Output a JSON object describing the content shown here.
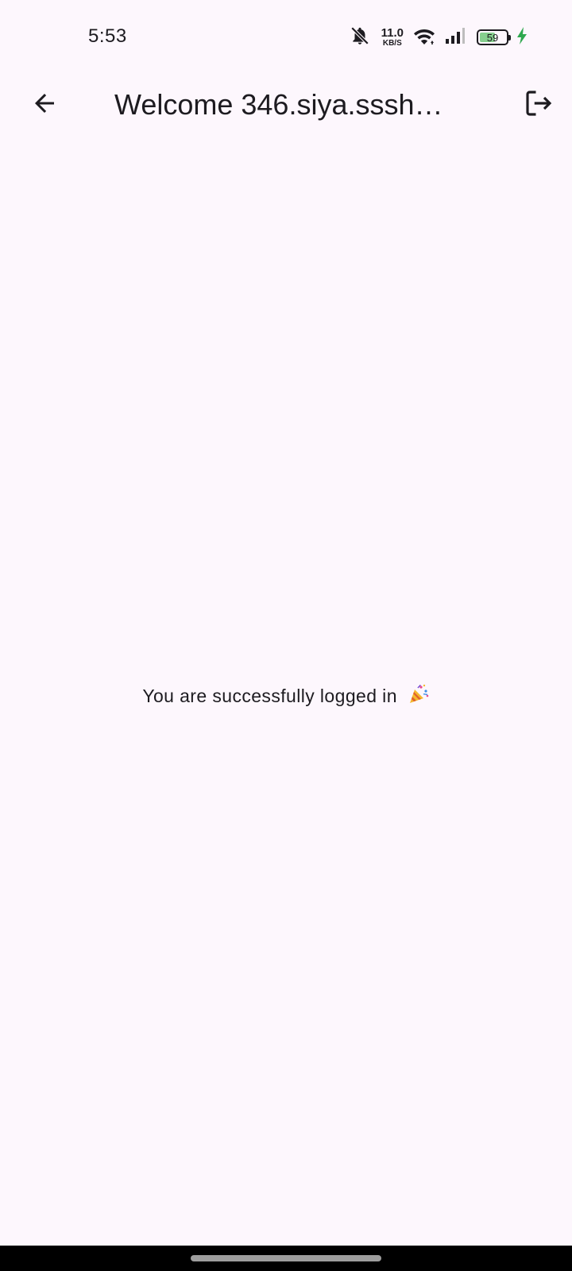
{
  "status_bar": {
    "time": "5:53",
    "net_speed_value": "11.0",
    "net_speed_unit": "KB/S",
    "battery_level": "59",
    "icons": [
      "bell-off-icon",
      "wifi-icon",
      "signal-icon",
      "battery-icon",
      "charging-bolt-icon"
    ]
  },
  "app_bar": {
    "title": "Welcome 346.siya.sssh…",
    "back_icon": "arrow-left-icon",
    "logout_icon": "logout-icon"
  },
  "body": {
    "message": "You are successfully logged in",
    "emoji_icon": "party-popper-icon"
  },
  "colors": {
    "background": "#fdf7fd",
    "text": "#1d1b20",
    "battery_fill": "#86cf8e",
    "charging": "#2fa84f"
  }
}
